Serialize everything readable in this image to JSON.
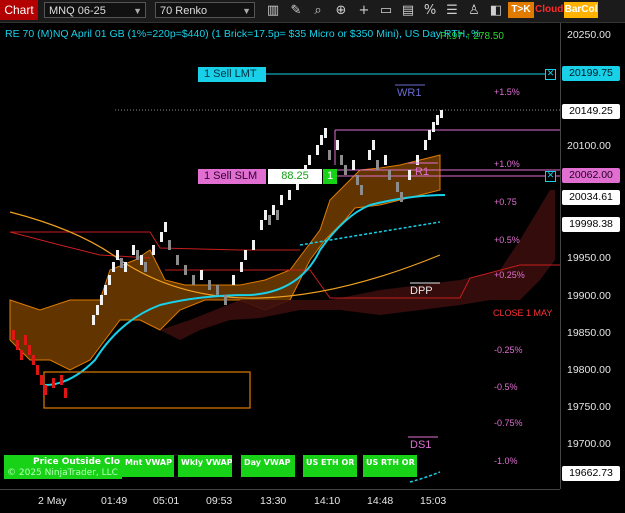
{
  "toolbar": {
    "tab_label": "Chart",
    "instrument": "MNQ 06-25",
    "period": "70 Renko",
    "icons": [
      "pencil-icon",
      "magnifier-icon",
      "zoom-in-icon",
      "crosshair-icon",
      "text-box-icon",
      "bar-style-icon",
      "percent-icon",
      "properties-icon",
      "strategy-icon",
      "chart-trader-icon",
      "grid-icon",
      "window-icon"
    ],
    "tok_label": "T>K",
    "cloud_label": "Cloud",
    "barcol_label": "BarCol",
    "tok_color": "#e07b00",
    "cloud_color": "#ff2a2a",
    "barcol_color": "#ffb300"
  },
  "chart_title": "RE 70 (M)NQ April 01 GB (1%=220p=$440) (1 Brick=17.5p= $35 Micro or $350 Mini), US Day RTH, %",
  "pnl_text": "Pl.97 ↑ 278.50",
  "price_axis": [
    "20250.00",
    "20200.00",
    "20150.00",
    "20100.00",
    "20050.00",
    "20000.00",
    "19950.00",
    "19900.00",
    "19850.00",
    "19800.00",
    "19750.00",
    "19700.00"
  ],
  "price_labels": {
    "sell_lmt": "20199.75",
    "last": "20149.25",
    "sell_slm": "20062.00",
    "line1": "20034.61",
    "line2": "19998.38",
    "bottom": "19662.73"
  },
  "time_axis": [
    "2 May",
    "01:49",
    "05:01",
    "09:53",
    "13:30",
    "14:10",
    "14:48",
    "15:03"
  ],
  "levels": {
    "wr1": "WR1",
    "r1": "R1",
    "dpp": "DPP",
    "ds1": "DS1",
    "close": "CLOSE 1 MAY",
    "pct_up": [
      "+1.5%",
      "+1.0%",
      "+0.75",
      "+0.5%",
      "+0.25%"
    ],
    "pct_down": [
      "-0.25%",
      "-0.5%",
      "-0.75%",
      "-1.0%"
    ]
  },
  "orders": {
    "sell_lmt_label": "1 Sell LMT",
    "sell_slm_label": "1 Sell SLM",
    "slm_value": "88.25",
    "slm_qty": "1"
  },
  "buttons": {
    "price_outside": "Price Outside Clo",
    "copyright": "© 2025 NinjaTrader, LLC",
    "mnt_vwap": "Mnt VWAP",
    "wkly_vwap": "Wkly VWAP",
    "day_vwap": "Day VWAP",
    "us_eth_or": "US ETH OR",
    "us_rth_or": "US RTH OR"
  },
  "colors": {
    "cyan": "#18d0e8",
    "green": "#17d217",
    "red": "#ff2a2a",
    "orange": "#e07b00",
    "pink": "#e06fd1",
    "background": "#000000"
  }
}
